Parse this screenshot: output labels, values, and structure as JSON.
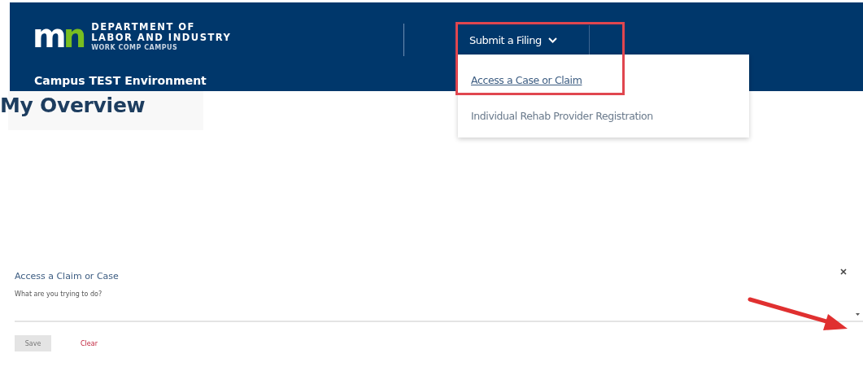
{
  "header": {
    "logo": {
      "mark": "m",
      "mark_accent": "n",
      "line_1": "DEPARTMENT OF",
      "line_2": "LABOR AND INDUSTRY",
      "line_3": "WORK COMP CAMPUS"
    },
    "environment": "Campus TEST Environment"
  },
  "nav": {
    "label": "Submit a Filing",
    "expanded": true,
    "menu": [
      {
        "label": "Access a Case or Claim",
        "selected": true
      },
      {
        "label": "Individual Rehab Provider Registration",
        "selected": false
      }
    ]
  },
  "page_title": "My Overview",
  "form": {
    "title": "Access a Claim or Case",
    "question": "What are you trying to do?",
    "buttons": [
      {
        "label": "Save",
        "kind": "primary",
        "disabled": true
      },
      {
        "label": "Clear",
        "kind": "link",
        "disabled": false
      }
    ]
  }
}
